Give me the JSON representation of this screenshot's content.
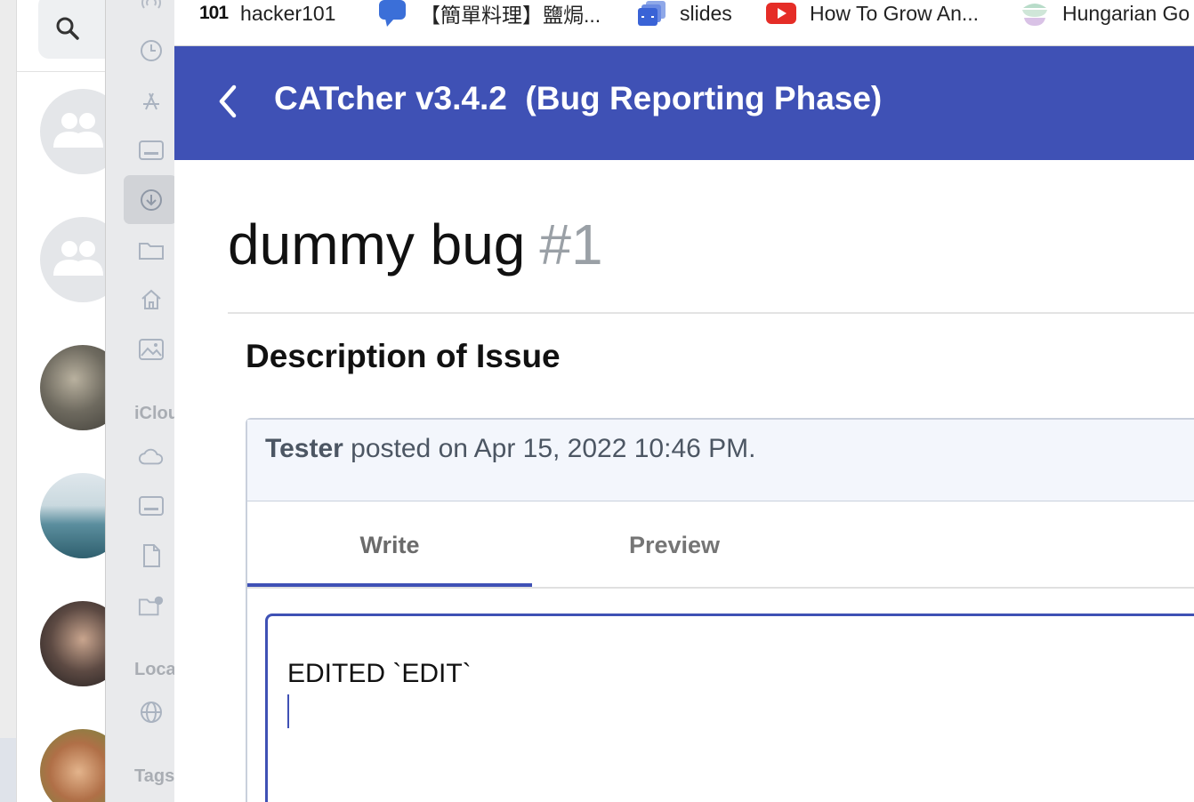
{
  "bookmarks": [
    {
      "icon": "101-logo-icon",
      "logo_text": "101",
      "label": "hacker101"
    },
    {
      "icon": "speech-bubble-icon",
      "label": "【簡單料理】鹽焗..."
    },
    {
      "icon": "slides-icon",
      "label": "slides"
    },
    {
      "icon": "youtube-icon",
      "label": "How To Grow An..."
    },
    {
      "icon": "stacked-bowls-icon",
      "label": "Hungarian Go"
    }
  ],
  "finder_sidebar": {
    "icloud_label": "iCloud",
    "locations_label": "Locations",
    "tags_label": "Tags"
  },
  "toolbar": {
    "back_icon": "chevron-left-icon",
    "title": "CATcher v3.4.2  (Bug Reporting Phase)"
  },
  "issue": {
    "title": "dummy bug",
    "number": "#1"
  },
  "description": {
    "heading": "Description of Issue",
    "author": "Tester",
    "posted_text": " posted on Apr 15, 2022 10:46 PM.",
    "tabs": [
      "Write",
      "Preview"
    ],
    "active_tab": "Write",
    "editor_value": "EDITED `EDIT`"
  },
  "colors": {
    "toolbar": "#3f51b5",
    "accent": "#3f51b5",
    "issue_number": "#9aa0a6",
    "comment_header_bg": "#f3f6fc"
  }
}
